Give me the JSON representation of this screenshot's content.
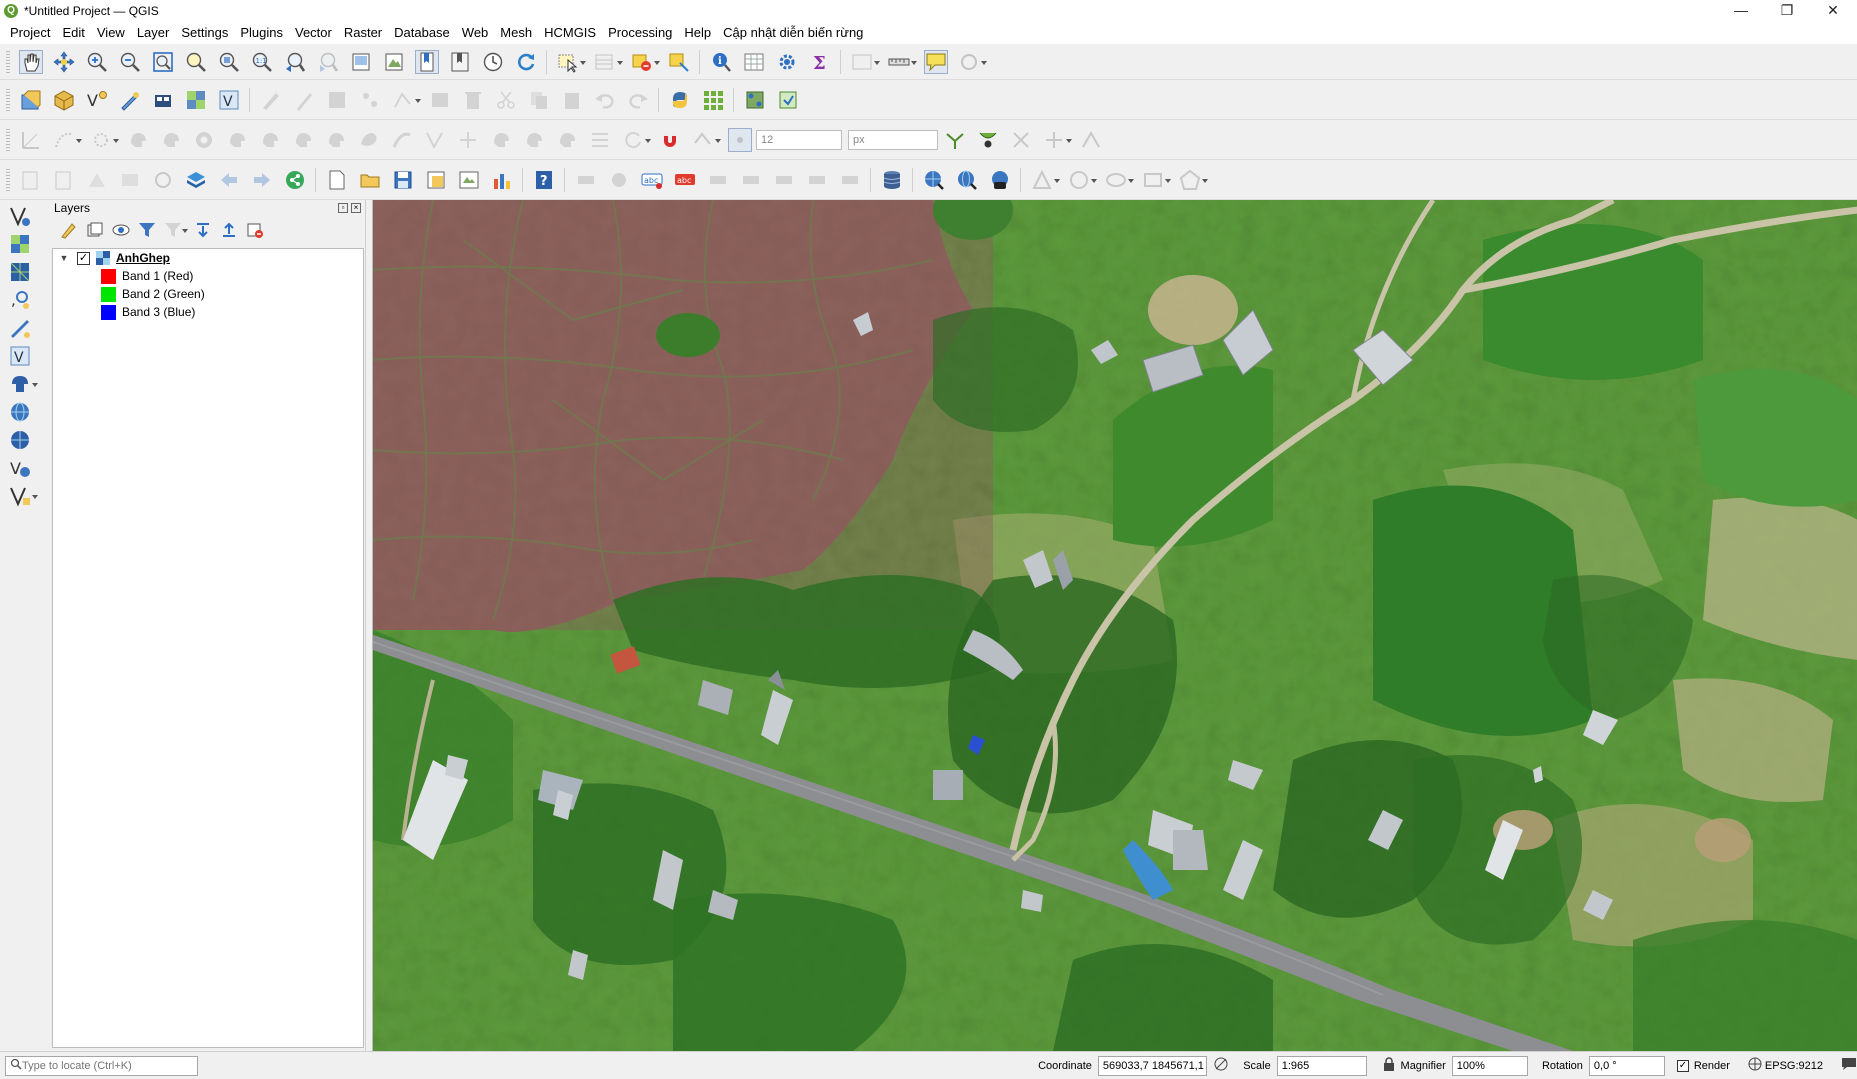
{
  "window": {
    "title": "*Untitled Project — QGIS",
    "app_icon_letter": "Q",
    "minimize_glyph": "—",
    "maximize_glyph": "❐",
    "close_glyph": "✕"
  },
  "menubar": {
    "items": [
      "Project",
      "Edit",
      "View",
      "Layer",
      "Settings",
      "Plugins",
      "Vector",
      "Raster",
      "Database",
      "Web",
      "Mesh",
      "HCMGIS",
      "Processing",
      "Help",
      "Cập nhật diễn biến rừng"
    ]
  },
  "toolbars": {
    "snapping_tolerance": "12",
    "snapping_units": "px"
  },
  "layers_panel": {
    "title": "Layers",
    "layers": [
      {
        "name": "AnhGhep",
        "checked": true,
        "check_glyph": "✓",
        "expander_glyph": "▼",
        "bands": [
          {
            "label": "Band 1 (Red)",
            "color": "#ff0000"
          },
          {
            "label": "Band 2 (Green)",
            "color": "#00e600"
          },
          {
            "label": "Band 3 (Blue)",
            "color": "#0000ff"
          }
        ]
      }
    ]
  },
  "statusbar": {
    "locator_placeholder": "Type to locate (Ctrl+K)",
    "coordinate_label": "Coordinate",
    "coordinate_value": "569033,7 1845671,1",
    "scale_label": "Scale",
    "scale_value": "1:965",
    "magnifier_label": "Magnifier",
    "magnifier_value": "100%",
    "rotation_label": "Rotation",
    "rotation_value": "0,0 °",
    "render_label": "Render",
    "render_checked": true,
    "crs": "EPSG:9212"
  },
  "colors": {
    "accent": "#589632",
    "field_brown": "#8a5e58",
    "vegetation_green": "#3f8a2e",
    "road_gray": "#8d8e92"
  }
}
